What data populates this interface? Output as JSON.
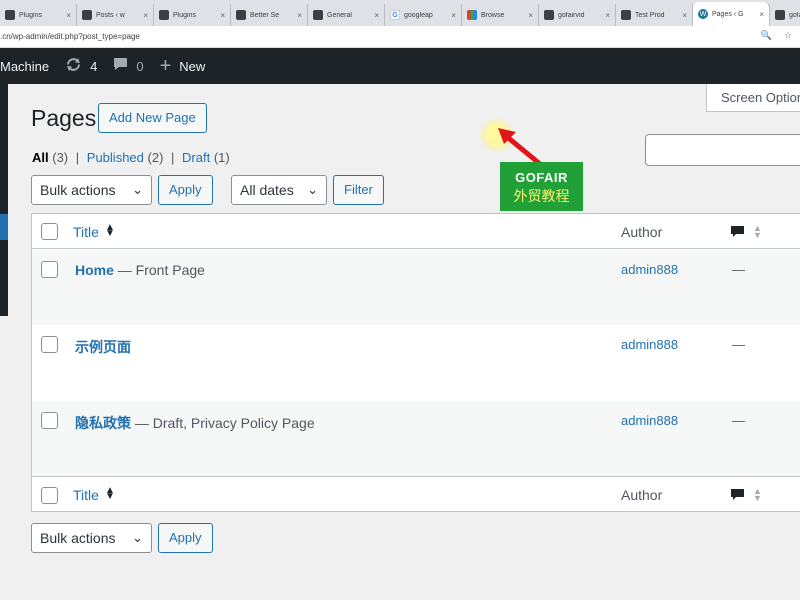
{
  "browser": {
    "tabs": [
      {
        "label": "Plugins",
        "icon": "app-icon"
      },
      {
        "label": "Posts ‹ w",
        "icon": "app-icon"
      },
      {
        "label": "Plugins",
        "icon": "app-icon"
      },
      {
        "label": "Better Se",
        "icon": "app-icon"
      },
      {
        "label": "General",
        "icon": "app-icon"
      },
      {
        "label": "googleap",
        "icon": "google-icon"
      },
      {
        "label": "Browse",
        "icon": "browse-icon"
      },
      {
        "label": "gofairvid",
        "icon": "app-icon"
      },
      {
        "label": "Test Prod",
        "icon": "app-icon"
      },
      {
        "label": "Pages ‹ G",
        "icon": "wordpress-icon",
        "active": true
      },
      {
        "label": "gofairvid",
        "icon": "app-icon"
      }
    ],
    "url": ".cn/wp-admin/edit.php?post_type=page"
  },
  "adminbar": {
    "site_name": "Machine",
    "updates_count": "4",
    "comments_count": "0",
    "new_label": "New"
  },
  "screen_options_label": "Screen Options",
  "page": {
    "title": "Pages",
    "add_new_label": "Add New Page"
  },
  "views": {
    "all_label": "All",
    "all_count": "(3)",
    "published_label": "Published",
    "published_count": "(2)",
    "draft_label": "Draft",
    "draft_count": "(1)",
    "separator": "|"
  },
  "filters": {
    "bulk_actions": "Bulk actions",
    "apply": "Apply",
    "all_dates": "All dates",
    "filter": "Filter"
  },
  "table": {
    "col_title": "Title",
    "col_author": "Author",
    "rows": [
      {
        "title": "Home",
        "state": " — Front Page",
        "author": "admin888",
        "comments": "—"
      },
      {
        "title": "示例页面",
        "state": "",
        "author": "admin888",
        "comments": "—"
      },
      {
        "title": "隐私政策",
        "state": " — Draft, Privacy Policy Page",
        "author": "admin888",
        "comments": "—"
      }
    ]
  },
  "bottom_filters": {
    "bulk_actions": "Bulk actions",
    "apply": "Apply"
  },
  "watermark": {
    "top": "GOFAIR",
    "bottom": "外贸教程"
  },
  "colors": {
    "link": "#2271b1",
    "adminbar": "#1d2327",
    "watermark_bg": "#21a038",
    "watermark_text": "#fdf36a"
  }
}
